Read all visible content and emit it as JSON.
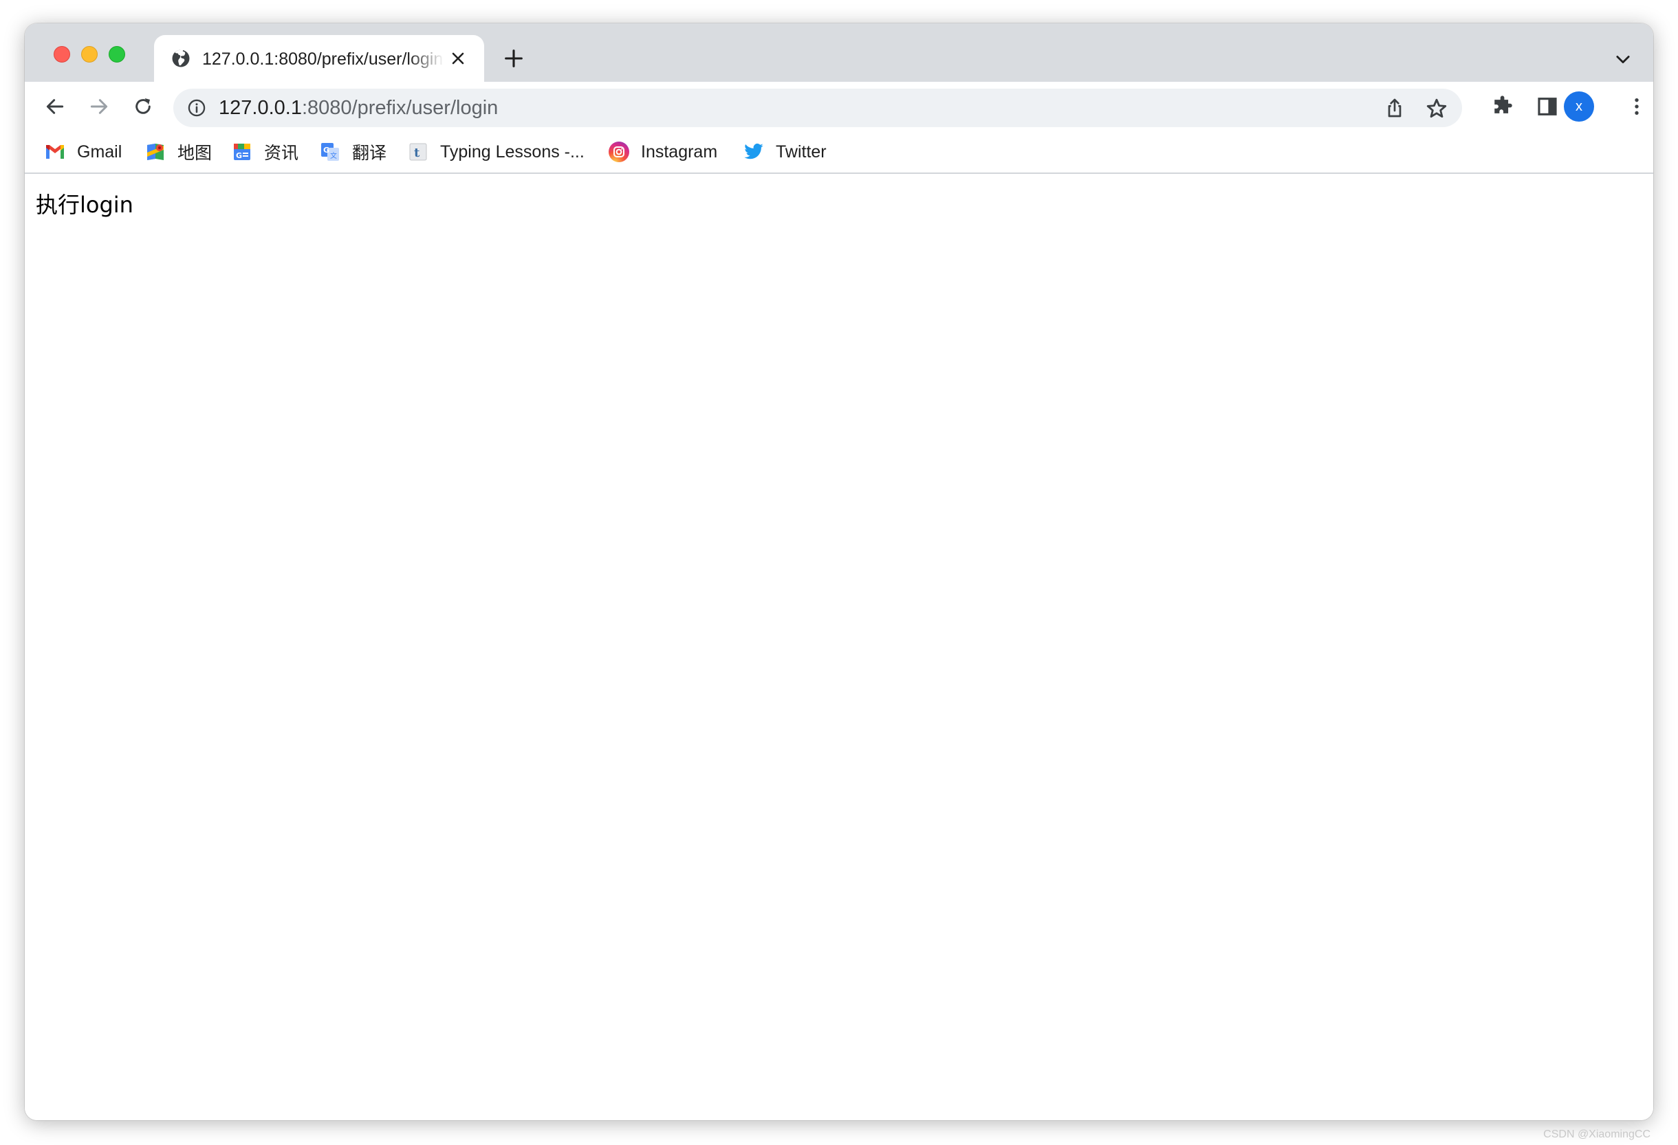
{
  "tab": {
    "title": "127.0.0.1:8080/prefix/user/login"
  },
  "omnibox": {
    "host": "127.0.0.1",
    "rest": ":8080/prefix/user/login"
  },
  "profile": {
    "initial": "x",
    "color": "#1a73e8"
  },
  "bookmarks": [
    {
      "label": "Gmail",
      "icon": "gmail-icon"
    },
    {
      "label": "地图",
      "icon": "maps-icon"
    },
    {
      "label": "资讯",
      "icon": "news-icon"
    },
    {
      "label": "翻译",
      "icon": "translate-icon"
    },
    {
      "label": "Typing Lessons -...",
      "icon": "typing-icon"
    },
    {
      "label": "Instagram",
      "icon": "instagram-icon"
    },
    {
      "label": "Twitter",
      "icon": "twitter-icon"
    }
  ],
  "page": {
    "body_text": "执行login"
  },
  "watermark": "CSDN @XiaomingCC"
}
